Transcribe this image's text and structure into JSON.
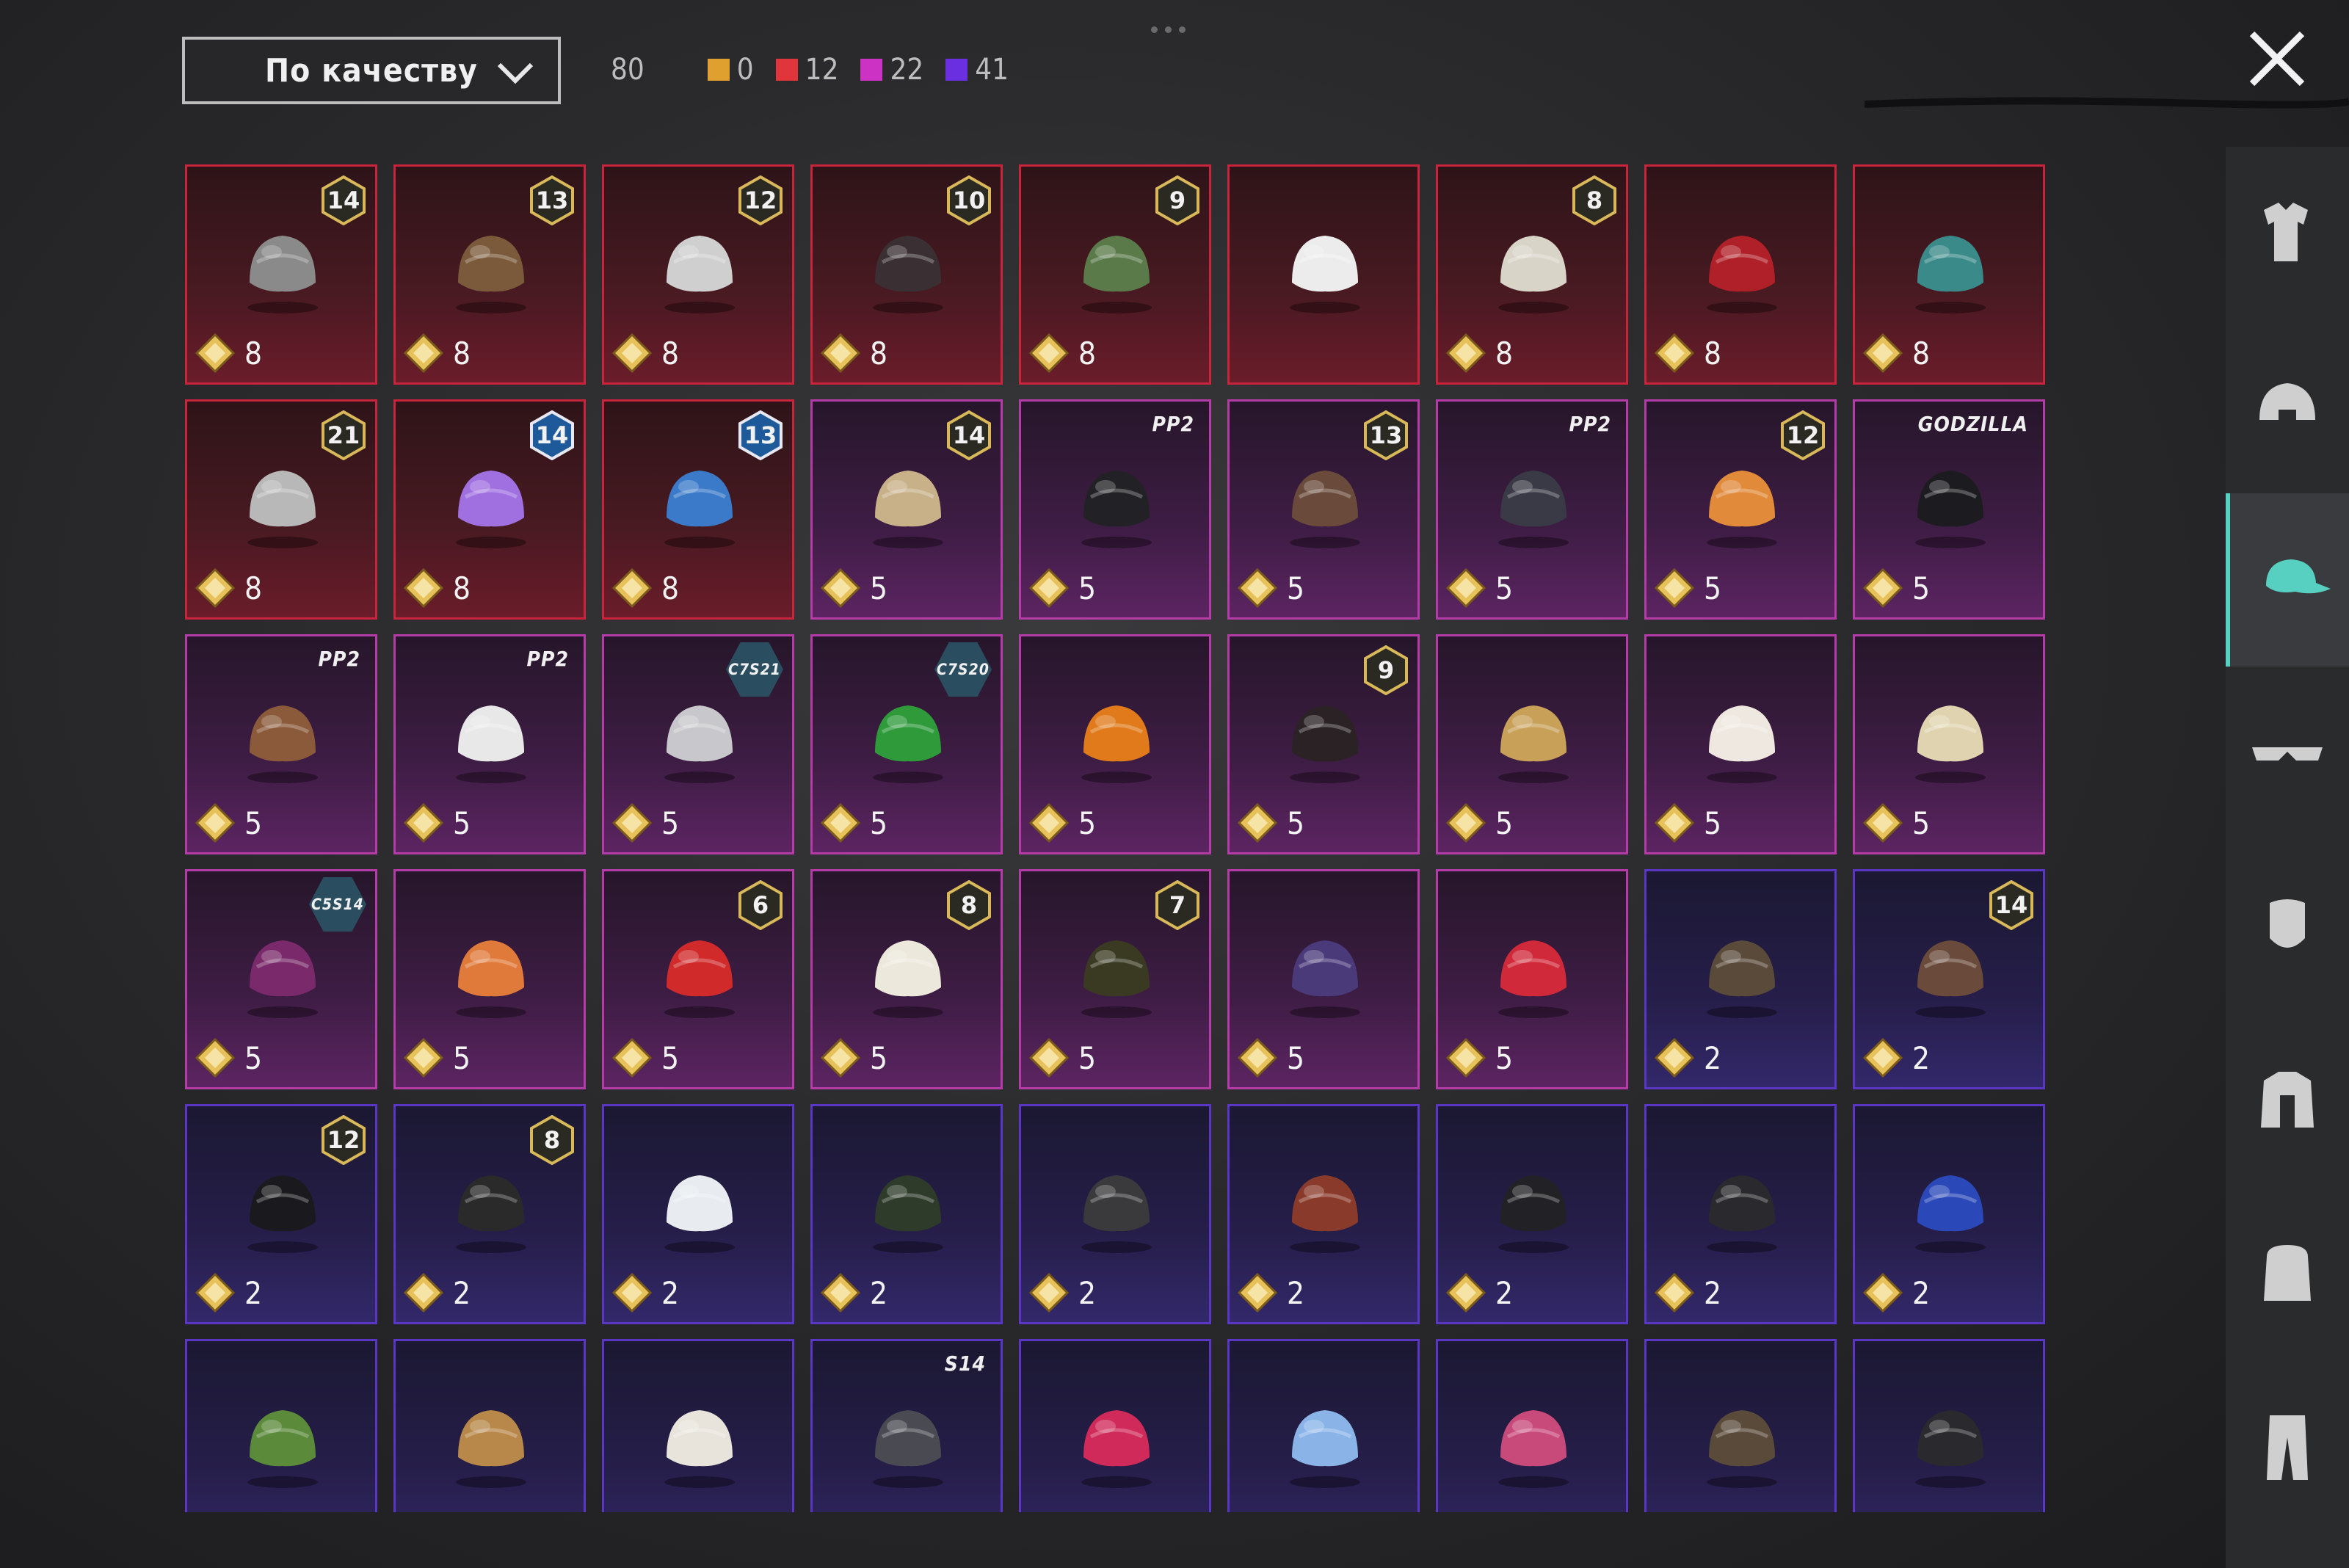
{
  "sort": {
    "label": "По качеству"
  },
  "counts": {
    "total": "80",
    "items": [
      {
        "value": "0",
        "color": "#e0a030"
      },
      {
        "value": "12",
        "color": "#e0353a"
      },
      {
        "value": "22",
        "color": "#cc33c4"
      },
      {
        "value": "41",
        "color": "#6a2fe0"
      }
    ]
  },
  "colors": {
    "red": "#c8243c",
    "pink": "#b43ba8",
    "purple": "#5a36c4",
    "accent": "#57d0c2",
    "gold": "#e7c15a"
  },
  "sidebar": {
    "items": [
      {
        "icon": "outfit-icon",
        "active": false
      },
      {
        "icon": "helmet-icon",
        "active": false
      },
      {
        "icon": "cap-icon",
        "active": true
      },
      {
        "icon": "glasses-icon",
        "active": false
      },
      {
        "icon": "mask-icon",
        "active": false
      },
      {
        "icon": "jacket-icon",
        "active": false
      },
      {
        "icon": "backpack-icon",
        "active": false
      },
      {
        "icon": "pants-icon",
        "active": false
      }
    ]
  },
  "items": [
    {
      "rarity": "red",
      "badge": "14",
      "price": "8",
      "art": "wolf-mask-hat",
      "c": "#8a8a8a"
    },
    {
      "rarity": "red",
      "badge": "13",
      "price": "8",
      "art": "flower-hat-wig",
      "c": "#7a5a3a"
    },
    {
      "rarity": "red",
      "badge": "12",
      "price": "8",
      "art": "white-bow-wig",
      "c": "#cfcfcf"
    },
    {
      "rarity": "red",
      "badge": "10",
      "price": "8",
      "art": "dark-wig",
      "c": "#3a3034"
    },
    {
      "rarity": "red",
      "badge": "9",
      "price": "8",
      "art": "zombie-head",
      "c": "#5a7a4a"
    },
    {
      "rarity": "red",
      "badge": "",
      "price": "",
      "art": "white-cowboy-hat",
      "c": "#ececec"
    },
    {
      "rarity": "red",
      "badge": "8",
      "price": "8",
      "art": "silver-wig",
      "c": "#d8d4c8"
    },
    {
      "rarity": "red",
      "badge": "",
      "price": "8",
      "art": "red-helmet",
      "c": "#b02028"
    },
    {
      "rarity": "red",
      "badge": "",
      "price": "8",
      "art": "dragon-helmet",
      "c": "#3a8a8a"
    },
    {
      "rarity": "red",
      "badge": "21",
      "price": "8",
      "art": "demon-mask",
      "c": "#b8b8b8"
    },
    {
      "rarity": "red",
      "badge": "14",
      "badge_style": "blue",
      "price": "8",
      "art": "purple-crystal-hat",
      "c": "#a070e0"
    },
    {
      "rarity": "red",
      "badge": "13",
      "badge_style": "blue",
      "price": "8",
      "art": "robot-helmet",
      "c": "#3a7ac8"
    },
    {
      "rarity": "pink",
      "badge": "14",
      "price": "5",
      "art": "blonde-wig-flower",
      "c": "#c8b088"
    },
    {
      "rarity": "pink",
      "tag": "PP2",
      "price": "5",
      "art": "black-wig",
      "c": "#222226"
    },
    {
      "rarity": "pink",
      "badge": "13",
      "price": "5",
      "art": "goggles-hair",
      "c": "#6a4a3a"
    },
    {
      "rarity": "pink",
      "tag": "PP2",
      "price": "5",
      "art": "cap-red-glasses",
      "c": "#3a3a46"
    },
    {
      "rarity": "pink",
      "badge": "12",
      "price": "5",
      "art": "orange-pigtails",
      "c": "#e08a3a"
    },
    {
      "rarity": "pink",
      "tag": "GODZILLA",
      "price": "5",
      "art": "black-hair-red-glasses",
      "c": "#1c1c20"
    },
    {
      "rarity": "pink",
      "tag": "PP2",
      "price": "5",
      "art": "bear-head",
      "c": "#8a5a3a"
    },
    {
      "rarity": "pink",
      "tag": "PP2",
      "price": "5",
      "art": "panda-head",
      "c": "#e8e8e8"
    },
    {
      "rarity": "pink",
      "tag": "C7S21",
      "tag_style": "hex",
      "price": "5",
      "art": "silver-hair",
      "c": "#c8c8cc"
    },
    {
      "rarity": "pink",
      "tag": "C7S20",
      "tag_style": "hex",
      "price": "5",
      "art": "green-hair",
      "c": "#2e9a3a"
    },
    {
      "rarity": "pink",
      "badge": "",
      "price": "5",
      "art": "pumpkin-head",
      "c": "#e07a1a"
    },
    {
      "rarity": "pink",
      "badge": "9",
      "price": "5",
      "art": "long-dark-wig",
      "c": "#2a2224"
    },
    {
      "rarity": "pink",
      "badge": "",
      "price": "5",
      "art": "long-blonde-wig",
      "c": "#c8a058"
    },
    {
      "rarity": "pink",
      "badge": "",
      "price": "5",
      "art": "white-tiger-hat",
      "c": "#efe8e0"
    },
    {
      "rarity": "pink",
      "badge": "",
      "price": "5",
      "art": "tiara-curly-wig",
      "c": "#e0d4b0"
    },
    {
      "rarity": "pink",
      "tag": "C5S14",
      "tag_style": "hex",
      "price": "5",
      "art": "purple-curly-hair",
      "c": "#7a2a6a"
    },
    {
      "rarity": "pink",
      "badge": "",
      "price": "5",
      "art": "orange-crown",
      "c": "#e07a3a"
    },
    {
      "rarity": "pink",
      "badge": "6",
      "price": "5",
      "art": "santa-hat-beard",
      "c": "#d02a2a"
    },
    {
      "rarity": "pink",
      "badge": "8",
      "price": "5",
      "art": "white-hat",
      "c": "#ece8dc"
    },
    {
      "rarity": "pink",
      "badge": "7",
      "price": "5",
      "art": "officer-cap",
      "c": "#3a3a22"
    },
    {
      "rarity": "pink",
      "badge": "",
      "price": "5",
      "art": "witch-hat-braids",
      "c": "#4a3a7a"
    },
    {
      "rarity": "pink",
      "badge": "",
      "price": "5",
      "art": "red-hair-cap",
      "c": "#d02a3a"
    },
    {
      "rarity": "purple",
      "badge": "",
      "price": "2",
      "art": "headband-hair",
      "c": "#5a4a3a"
    },
    {
      "rarity": "purple",
      "badge": "14",
      "price": "2",
      "art": "cat-ear-cap-wig",
      "c": "#6a4a3a"
    },
    {
      "rarity": "purple",
      "badge": "12",
      "price": "2",
      "art": "bunny-ear-helmet",
      "c": "#1a1a1e"
    },
    {
      "rarity": "purple",
      "badge": "8",
      "price": "2",
      "art": "hooded-skull",
      "c": "#2a2a2a"
    },
    {
      "rarity": "purple",
      "badge": "",
      "price": "2",
      "art": "white-blue-cap",
      "c": "#e8ecf0"
    },
    {
      "rarity": "purple",
      "badge": "",
      "price": "2",
      "art": "tactical-gas-helmet",
      "c": "#2e3a2a"
    },
    {
      "rarity": "purple",
      "badge": "",
      "price": "2",
      "art": "hockey-helmet",
      "c": "#3a3a3c"
    },
    {
      "rarity": "purple",
      "badge": "",
      "price": "2",
      "art": "goggles-red-hair",
      "c": "#8a3a2a"
    },
    {
      "rarity": "purple",
      "badge": "",
      "price": "2",
      "art": "black-cap",
      "c": "#222226"
    },
    {
      "rarity": "purple",
      "badge": "",
      "price": "2",
      "art": "witch-hat",
      "c": "#2a2a2e"
    },
    {
      "rarity": "purple",
      "badge": "",
      "price": "2",
      "art": "cricket-helmet",
      "c": "#2a48b8"
    },
    {
      "rarity": "purple",
      "badge": "",
      "price": "",
      "art": "green-cap",
      "c": "#5a8a3a"
    },
    {
      "rarity": "purple",
      "badge": "",
      "price": "",
      "art": "beanie",
      "c": "#b8884a"
    },
    {
      "rarity": "purple",
      "badge": "",
      "price": "",
      "art": "turban",
      "c": "#e8e4dc"
    },
    {
      "rarity": "purple",
      "tag": "S14",
      "price": "",
      "art": "knight-helmet",
      "c": "#4a4a52"
    },
    {
      "rarity": "purple",
      "badge": "",
      "price": "",
      "art": "pink-cap",
      "c": "#d02a5a"
    },
    {
      "rarity": "purple",
      "badge": "",
      "price": "",
      "art": "bunny-ear-headband",
      "c": "#8ab4e8"
    },
    {
      "rarity": "purple",
      "badge": "",
      "price": "",
      "art": "pink-beret",
      "c": "#c84a7a"
    },
    {
      "rarity": "purple",
      "badge": "",
      "price": "",
      "art": "aviator-helmet",
      "c": "#5a4a3a"
    },
    {
      "rarity": "purple",
      "badge": "",
      "price": "",
      "art": "dark-cap",
      "c": "#2a2a2e"
    }
  ]
}
